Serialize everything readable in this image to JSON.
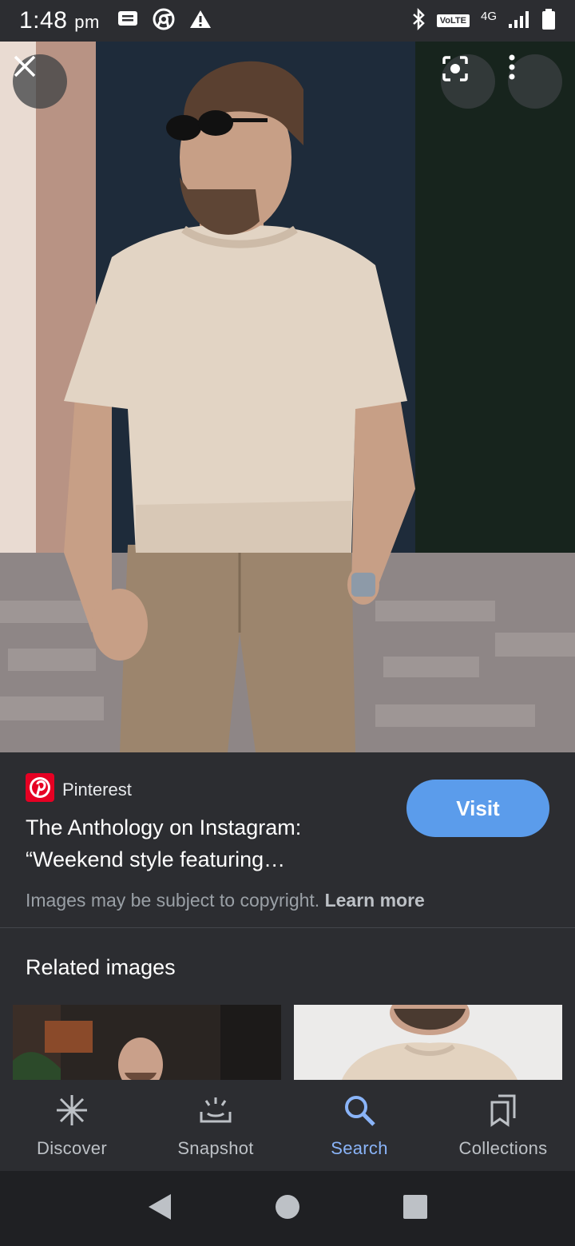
{
  "status_bar": {
    "time": "1:48",
    "ampm": "pm",
    "left_icons": [
      "message-icon",
      "chrome-icon",
      "warning-icon"
    ],
    "right_icons": [
      "bluetooth-icon",
      "signal-icon",
      "battery-icon"
    ],
    "volte": "VoLTE",
    "network": "4G"
  },
  "hero": {
    "buttons": [
      "close-icon",
      "lens-icon",
      "more-vert-icon"
    ]
  },
  "result": {
    "source_name": "Pinterest",
    "title": "The Anthology on Instagram: “Weekend style featuring…",
    "visit_label": "Visit",
    "copyright_text": "Images may be subject to copyright.",
    "learn_more_label": "Learn more"
  },
  "related": {
    "heading": "Related images"
  },
  "bottom_nav": {
    "items": [
      {
        "label": "Discover",
        "icon": "asterisk-icon"
      },
      {
        "label": "Snapshot",
        "icon": "snapshot-icon"
      },
      {
        "label": "Search",
        "icon": "search-icon"
      },
      {
        "label": "Collections",
        "icon": "collections-icon"
      }
    ],
    "active": "Search"
  },
  "system_nav": [
    "back-icon",
    "home-icon",
    "recents-icon"
  ],
  "colors": {
    "background": "#2c2d31",
    "accent": "#5b9ceb",
    "active_nav": "#8ab4f8",
    "pinterest_red": "#e60023"
  }
}
